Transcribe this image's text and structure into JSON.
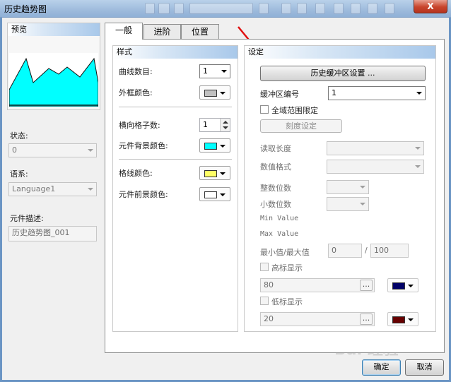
{
  "window": {
    "title": "历史趋势图",
    "close_label": "X"
  },
  "preview": {
    "title": "预览"
  },
  "left": {
    "state_label": "状态:",
    "state_value": "0",
    "lang_label": "语系:",
    "lang_value": "Language1",
    "desc_label": "元件描述:",
    "desc_value": "历史趋势图_001"
  },
  "tabs": [
    {
      "label": "一般"
    },
    {
      "label": "进阶"
    },
    {
      "label": "位置"
    }
  ],
  "style_group": {
    "title": "样式",
    "curve_count_label": "曲线数目:",
    "curve_count_value": "1",
    "frame_color_label": "外框颜色:",
    "frame_color": "#c0c0c0",
    "hgrid_label": "横向格子数:",
    "hgrid_value": "1",
    "bg_color_label": "元件背景颜色:",
    "bg_color": "#00ffff",
    "grid_color_label": "格线颜色:",
    "grid_color": "#ffff66",
    "fg_color_label": "元件前景颜色:",
    "fg_color": "#ffffff"
  },
  "settings_group": {
    "title": "设定",
    "history_buffer_btn": "历史缓冲区设置 ...",
    "buffer_no_label": "缓冲区编号",
    "buffer_no_value": "1",
    "global_range_label": "全域范围限定",
    "scale_btn": "刻度设定",
    "read_length_label": "读取长度",
    "value_format_label": "数值格式",
    "int_digits_label": "整数位数",
    "dec_digits_label": "小数位数",
    "min_value_label": "Min Value",
    "max_value_label": "Max Value",
    "minmax_label": "最小值/最大值",
    "min_value": "0",
    "slash": "/",
    "max_value": "100",
    "high_mark_label": "高标显示",
    "high_mark_value": "80",
    "high_mark_color": "#000066",
    "low_mark_label": "低标显示",
    "low_mark_value": "20",
    "low_mark_color": "#660000",
    "ellipsis": "..."
  },
  "footer": {
    "ok_label": "确定",
    "cancel_label": "取消"
  },
  "watermark": {
    "text": "Bai 经验"
  },
  "colors": {
    "arrow": "#e01010",
    "preview_fill": "#00ffff"
  }
}
